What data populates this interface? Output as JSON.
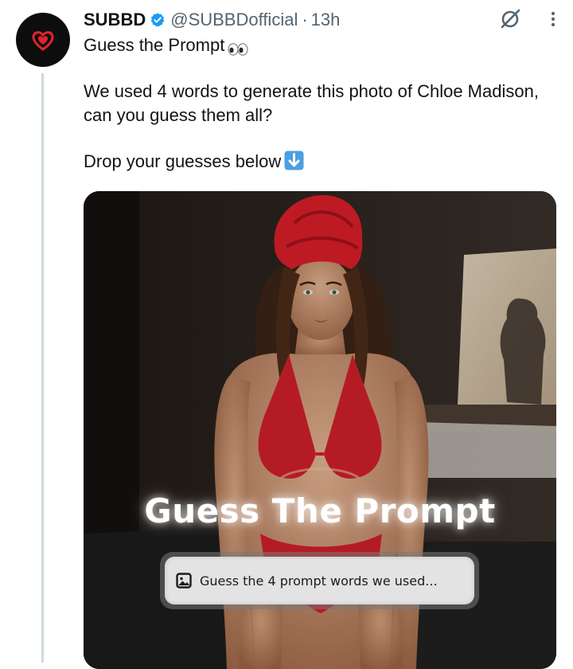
{
  "tweet": {
    "author": {
      "display_name": "SUBBD",
      "handle": "@SUBBDofficial",
      "verified": true,
      "avatar_icon": "devil-heart-logo"
    },
    "separator": "·",
    "time": "13h",
    "lines": [
      "Guess the Prompt",
      "We used 4 words to generate this photo of Chloe Madison,",
      "can you guess them all?",
      "Drop your guesses below"
    ],
    "emojis": {
      "title": "eyes-emoji",
      "cta": "down-arrow-emoji"
    },
    "actions": {
      "grok_icon": "grok-icon",
      "more_icon": "more-vertical-icon"
    },
    "media": {
      "overlay_title": "Guess The Prompt",
      "prompt_placeholder": "Guess the 4 prompt words we used...",
      "prompt_icon": "image-icon"
    }
  },
  "colors": {
    "text_primary": "#0f1419",
    "text_secondary": "#536471",
    "verified_blue": "#1d9bf0",
    "thread_line": "#cfd9de",
    "brand_red": "#e0242c"
  }
}
